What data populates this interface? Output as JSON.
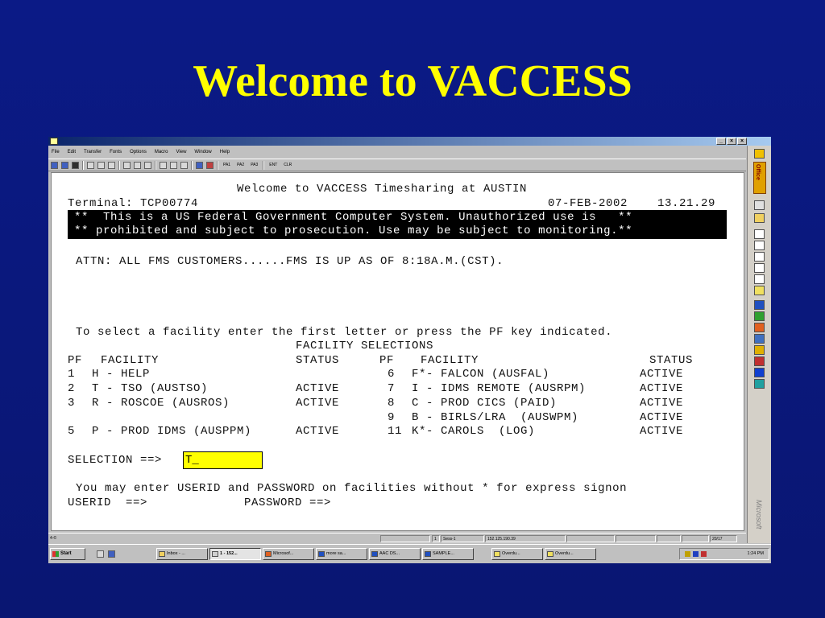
{
  "slide": {
    "title": "Welcome to VACCESS"
  },
  "window": {
    "buttons": [
      "_",
      "×",
      "×"
    ],
    "menu": [
      "File",
      "Edit",
      "Transfer",
      "Fonts",
      "Options",
      "Macro",
      "View",
      "Window",
      "Help"
    ],
    "toolbar_text": [
      "PA1",
      "PA2",
      "PA3",
      "ENT",
      "CLR"
    ]
  },
  "terminal": {
    "header": "Welcome to VACCESS Timesharing at AUSTIN",
    "terminal_line": "Terminal: TCP00774",
    "date": "07-FEB-2002",
    "time": "13.21.29",
    "warning1": "**  This is a US Federal Government Computer System. Unauthorized use is   **",
    "warning2": "** prohibited and subject to prosecution. Use may be subject to monitoring.**",
    "attn": "ATTN: ALL FMS CUSTOMERS......FMS IS UP AS OF 8:18A.M.(CST).",
    "instructions": "To select a facility enter the first letter or press the PF key indicated.",
    "selections_title": "FACILITY SELECTIONS",
    "col_headers": {
      "left_pf": "PF",
      "left_facility": "FACILITY",
      "left_status": "STATUS",
      "right_pf": "PF",
      "right_facility": "FACILITY",
      "right_status": "STATUS"
    },
    "left_rows": [
      {
        "pf": "1",
        "facility": "H - HELP",
        "status": ""
      },
      {
        "pf": "2",
        "facility": "T - TSO (AUSTSO)",
        "status": "ACTIVE"
      },
      {
        "pf": "3",
        "facility": "R - ROSCOE (AUSROS)",
        "status": "ACTIVE"
      },
      {
        "pf": "5",
        "facility": "P - PROD IDMS (AUSPPM)",
        "status": "ACTIVE"
      }
    ],
    "right_rows": [
      {
        "pf": "6",
        "facility": "F*- FALCON (AUSFAL)",
        "status": "ACTIVE"
      },
      {
        "pf": "7",
        "facility": "I - IDMS REMOTE (AUSRPM)",
        "status": "ACTIVE"
      },
      {
        "pf": "8",
        "facility": "C - PROD CICS (PAID)",
        "status": "ACTIVE"
      },
      {
        "pf": "9",
        "facility": "B - BIRLS/LRA  (AUSWPM)",
        "status": "ACTIVE"
      },
      {
        "pf": "11",
        "facility": "K*- CAROLS  (LOG)",
        "status": "ACTIVE"
      }
    ],
    "selection_label": "SELECTION ==>",
    "selection_value": "T_",
    "express_note": "You may enter USERID and PASSWORD on facilities without * for express signon",
    "userid_label": "USERID  ==>",
    "password_label": "PASSWORD ==>"
  },
  "officebar": {
    "logo": "Office",
    "brand": "Microsoft"
  },
  "statusbar": {
    "left": "4-©",
    "session_num": "1",
    "session": "Sess-1",
    "ip": "152.125.190.39",
    "cursor": "20/17"
  },
  "taskbar": {
    "start": "Start",
    "tasks": [
      "Inbox - ...",
      "1 - 152...",
      "Microsof...",
      "more sa...",
      "AAC DS...",
      "SAMPLE...",
      "Overdu...",
      "Overdu..."
    ],
    "clock": "1:24 PM"
  }
}
